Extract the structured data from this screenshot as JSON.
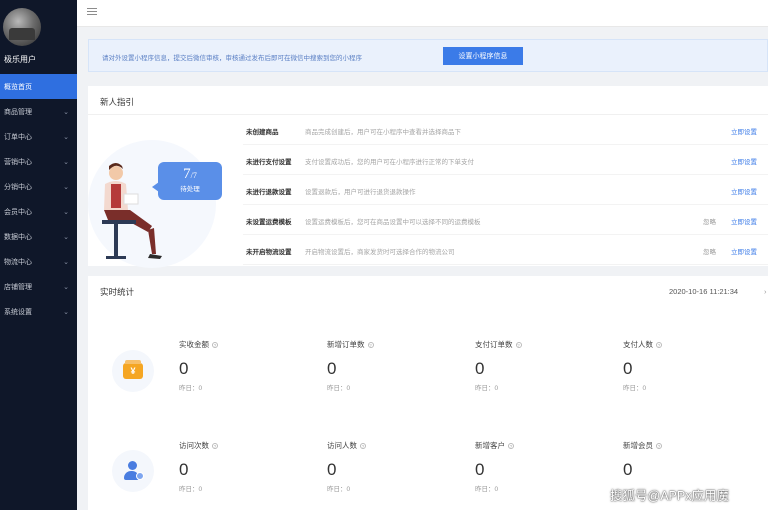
{
  "sidebar": {
    "shop_name": "极乐用户",
    "menu": [
      {
        "label": "概览首页",
        "active": true
      },
      {
        "label": "商品管理"
      },
      {
        "label": "订单中心"
      },
      {
        "label": "营销中心"
      },
      {
        "label": "分销中心"
      },
      {
        "label": "会员中心"
      },
      {
        "label": "数据中心"
      },
      {
        "label": "物流中心"
      },
      {
        "label": "店铺管理"
      },
      {
        "label": "系统设置"
      }
    ]
  },
  "notice": {
    "text": "请对外设置小程序信息，提交后微信审核，审核通过发布后即可在微信中搜索到您的小程序",
    "button": "设置小程序信息"
  },
  "guide": {
    "title": "新人指引",
    "progress_num": "7",
    "progress_total": "/7",
    "progress_label": "待处理",
    "rows": [
      {
        "title": "未创建商品",
        "desc": "商品完成创建后，用户可在小程序中查看并选择商品下",
        "skip": "",
        "action": "立即设置"
      },
      {
        "title": "未进行支付设置",
        "desc": "支付设置成功后，您的用户可在小程序进行正常的下单支付",
        "skip": "",
        "action": "立即设置"
      },
      {
        "title": "未进行退款设置",
        "desc": "设置退款后，用户可进行退货退款操作",
        "skip": "",
        "action": "立即设置"
      },
      {
        "title": "未设置运费模板",
        "desc": "设置运费模板后，您可在商品设置中可以选择不同的运费模板",
        "skip": "忽略",
        "action": "立即设置"
      },
      {
        "title": "未开启物流设置",
        "desc": "开启物流设置后，商家发货时可选择合作的物流公司",
        "skip": "忽略",
        "action": "立即设置"
      }
    ]
  },
  "stats": {
    "title": "实时统计",
    "timestamp": "2020-10-16 11:21:34",
    "row1": [
      {
        "label": "实收金额",
        "value": "0",
        "sub": "昨日：0"
      },
      {
        "label": "新增订单数",
        "value": "0",
        "sub": "昨日：0"
      },
      {
        "label": "支付订单数",
        "value": "0",
        "sub": "昨日：0"
      },
      {
        "label": "支付人数",
        "value": "0",
        "sub": "昨日：0"
      }
    ],
    "row2": [
      {
        "label": "访问次数",
        "value": "0",
        "sub": "昨日：0"
      },
      {
        "label": "访问人数",
        "value": "0",
        "sub": "昨日：0"
      },
      {
        "label": "新增客户",
        "value": "0",
        "sub": "昨日：0"
      },
      {
        "label": "新增会员",
        "value": "0",
        "sub": ""
      }
    ],
    "icons": [
      "wallet-icon",
      "user-icon"
    ],
    "wallet_glyph": "¥"
  },
  "watermark": "搜狐号@APPx应用魔",
  "colors": {
    "sidebar": "#0f1729",
    "accent": "#3b7be8",
    "wallet": "#f5a623"
  }
}
